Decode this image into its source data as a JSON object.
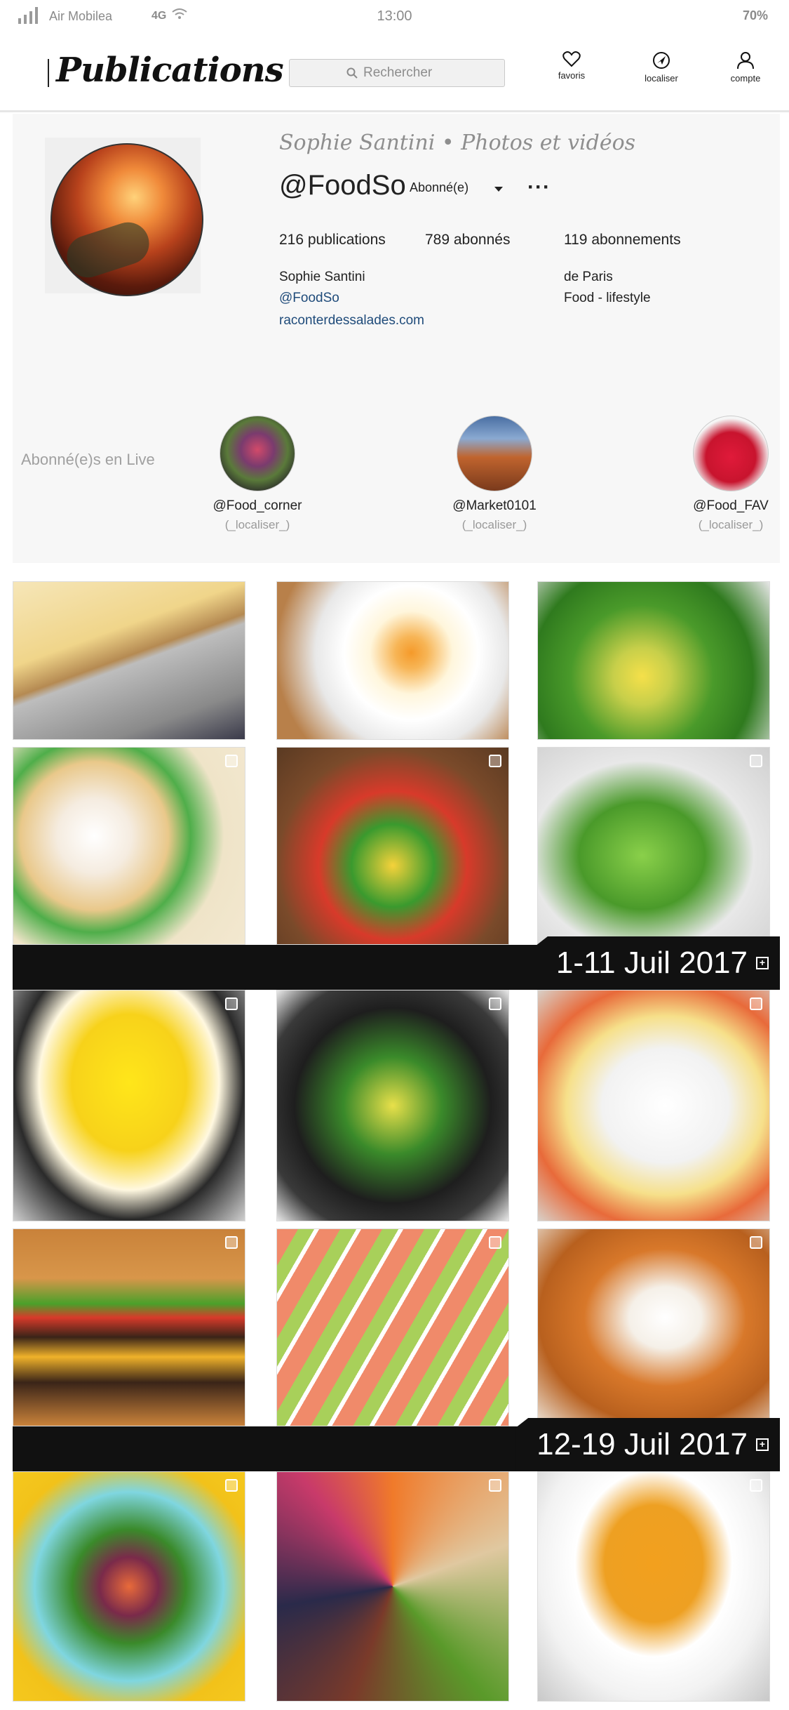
{
  "status_bar": {
    "carrier": "Air Mobilea",
    "network": "4G",
    "time": "13:00",
    "battery": "70%"
  },
  "header": {
    "logo": "Publications",
    "search_placeholder": "Rechercher",
    "nav": {
      "favorites": "favoris",
      "locate": "localiser",
      "account": "compte"
    }
  },
  "profile": {
    "full_name_title": "Sophie Santini • Photos et vidéos",
    "handle": "@FoodSo",
    "follow_status": "Abonné(e)",
    "more": "···",
    "stats": {
      "publications": "216 publications",
      "followers": "789 abonnés",
      "following": "119 abonnements"
    },
    "bio": {
      "name": "Sophie Santini",
      "handle": "@FoodSo",
      "website": "raconterdessalades.com",
      "location": "de Paris",
      "category": "Food - lifestyle"
    }
  },
  "live": {
    "label": "Abonné(e)s en Live",
    "users": [
      {
        "name": "@Food_corner",
        "action": "(_localiser_)"
      },
      {
        "name": "@Market0101",
        "action": "(_localiser_)"
      },
      {
        "name": "@Food_FAV",
        "action": "(_localiser_)"
      }
    ]
  },
  "date_bars": [
    {
      "label": "1-11 Juil 2017",
      "icon": "plus-box-icon"
    },
    {
      "label": "12-19 Juil 2017",
      "icon": "plus-box-icon"
    }
  ],
  "photos": [
    {
      "name": "cheesecake-berries"
    },
    {
      "name": "baked-egg"
    },
    {
      "name": "green-bowl"
    },
    {
      "name": "roasted-cauliflower"
    },
    {
      "name": "veggie-salad"
    },
    {
      "name": "pesto-pasta"
    },
    {
      "name": "lemon-cheesecake"
    },
    {
      "name": "skillet-hash"
    },
    {
      "name": "salmon-dish"
    },
    {
      "name": "burger"
    },
    {
      "name": "grapefruit-avocado"
    },
    {
      "name": "curry-rice"
    },
    {
      "name": "colorful-salad"
    },
    {
      "name": "grain-bowl"
    },
    {
      "name": "pumpkin-soup"
    }
  ]
}
